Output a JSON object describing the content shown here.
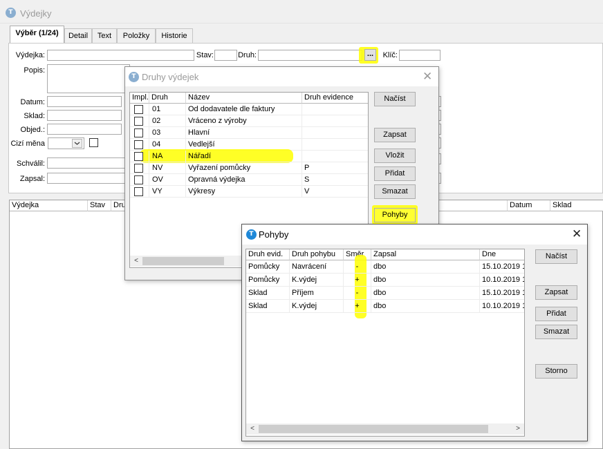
{
  "main": {
    "title": "Výdejky",
    "tabs": [
      "Výběr (1/24)",
      "Detail",
      "Text",
      "Položky",
      "Historie"
    ],
    "labels": {
      "vydejka": "Výdejka:",
      "stav": "Stav:",
      "druh": "Druh:",
      "klic": "Klíč:",
      "popis": "Popis:",
      "datum": "Datum:",
      "sklad": "Sklad:",
      "objed": "Objed.:",
      "cizi_mena": "Cizí měna",
      "schvalil": "Schválil:",
      "zapsal": "Zapsal:"
    },
    "druh_button": "...",
    "list_headers": [
      "Výdejka",
      "Stav",
      "Dru",
      "Datum",
      "Sklad"
    ]
  },
  "druhy_dialog": {
    "title": "Druhy výdejek",
    "columns": [
      "Impl.",
      "Druh",
      "Název",
      "Druh evidence"
    ],
    "rows": [
      {
        "druh": "01",
        "nazev": "Od dodavatele dle faktury",
        "evidence": "",
        "extra": ""
      },
      {
        "druh": "02",
        "nazev": "Vráceno z výroby",
        "evidence": "",
        "extra": ""
      },
      {
        "druh": "03",
        "nazev": "Hlavní",
        "evidence": "",
        "extra": ""
      },
      {
        "druh": "04",
        "nazev": "Vedlejší",
        "evidence": "",
        "extra": ""
      },
      {
        "druh": "NA",
        "nazev": "Nářadí",
        "evidence": "",
        "extra": ""
      },
      {
        "druh": "NV",
        "nazev": "Vyřazení pomůcky",
        "evidence": "P",
        "extra": "("
      },
      {
        "druh": "OV",
        "nazev": "Opravná výdejka",
        "evidence": "S",
        "extra": "I"
      },
      {
        "druh": "VY",
        "nazev": "Výkresy",
        "evidence": "V",
        "extra": "'"
      }
    ],
    "buttons": {
      "nacist": "Načíst",
      "zapsat": "Zapsat",
      "vlozit": "Vložit",
      "pridat": "Přidat",
      "smazat": "Smazat",
      "pohyby": "Pohyby"
    }
  },
  "pohyby_dialog": {
    "title": "Pohyby",
    "columns": [
      "Druh evid.",
      "Druh pohybu",
      "Směr",
      "Zapsal",
      "Dne"
    ],
    "rows": [
      {
        "evid": "Pomůcky",
        "pohyb": "Navrácení",
        "smer": "-",
        "zapsal": "dbo",
        "dne": "15.10.2019 1"
      },
      {
        "evid": "Pomůcky",
        "pohyb": "K.výdej",
        "smer": "+",
        "zapsal": "dbo",
        "dne": "10.10.2019 1"
      },
      {
        "evid": "Sklad",
        "pohyb": "Příjem",
        "smer": "-",
        "zapsal": "dbo",
        "dne": "15.10.2019 1"
      },
      {
        "evid": "Sklad",
        "pohyb": "K.výdej",
        "smer": "+",
        "zapsal": "dbo",
        "dne": "10.10.2019 1"
      }
    ],
    "buttons": {
      "nacist": "Načíst",
      "zapsat": "Zapsat",
      "pridat": "Přidat",
      "smazat": "Smazat",
      "storno": "Storno"
    }
  },
  "icons": {
    "app": "T",
    "close": "✕",
    "scroll_left": "<",
    "scroll_right": ">",
    "dropdown": "chevron-down"
  },
  "highlight_color": "#ffff00"
}
